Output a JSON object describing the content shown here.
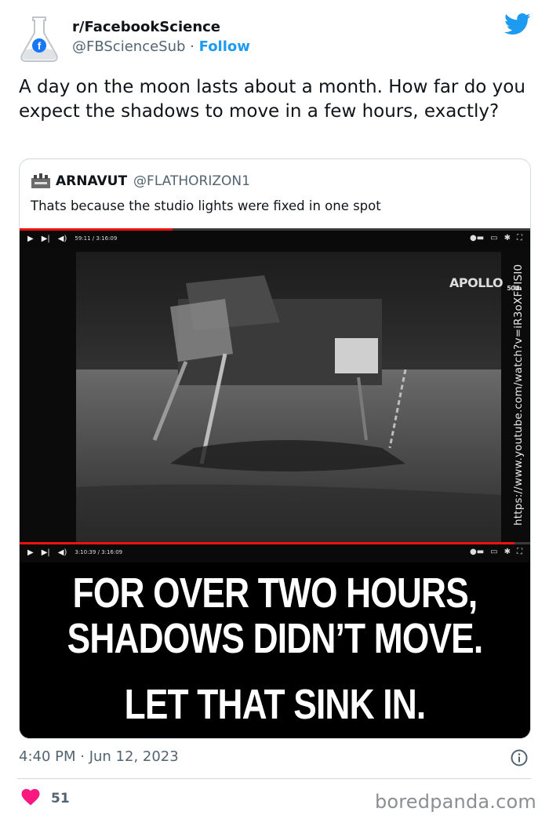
{
  "tweet": {
    "display_name": "r/FacebookScience",
    "handle": "@FBScienceSub",
    "separator": "·",
    "follow_label": "Follow",
    "text": "A day on the moon lasts about a month. How far do you expect the shadows to move in a few hours, exactly?",
    "timestamp": "4:40 PM · Jun 12, 2023",
    "like_count": "51"
  },
  "quoted": {
    "display_name": "ARNAVUT",
    "handle": "@FLATHORIZON1",
    "text": "Thats because the studio lights were fixed in one spot",
    "video": {
      "top_time": "59:11 / 3:16:09",
      "bottom_time": "3:10:39 / 3:16:09",
      "top_progress": 0.3,
      "bottom_progress": 0.97,
      "apollo_logo_text": "APOLLO",
      "apollo_logo_sub": "50th",
      "side_url": "https://www.youtube.com/watch?v=iR3oXFFISI0",
      "caption_lines": [
        "FOR OVER TWO HOURS,",
        "SHADOWS DIDN’T MOVE.",
        "LET THAT SINK IN."
      ]
    }
  },
  "watermark": "boredpanda.com",
  "colors": {
    "accent": "#1d9bf0",
    "like": "#f91880",
    "muted": "#536471"
  },
  "icons": [
    "flask-facebook-avatar",
    "twitter-bird-icon",
    "info-icon",
    "heart-icon",
    "play-icon",
    "next-icon",
    "volume-icon",
    "settings-icon"
  ]
}
